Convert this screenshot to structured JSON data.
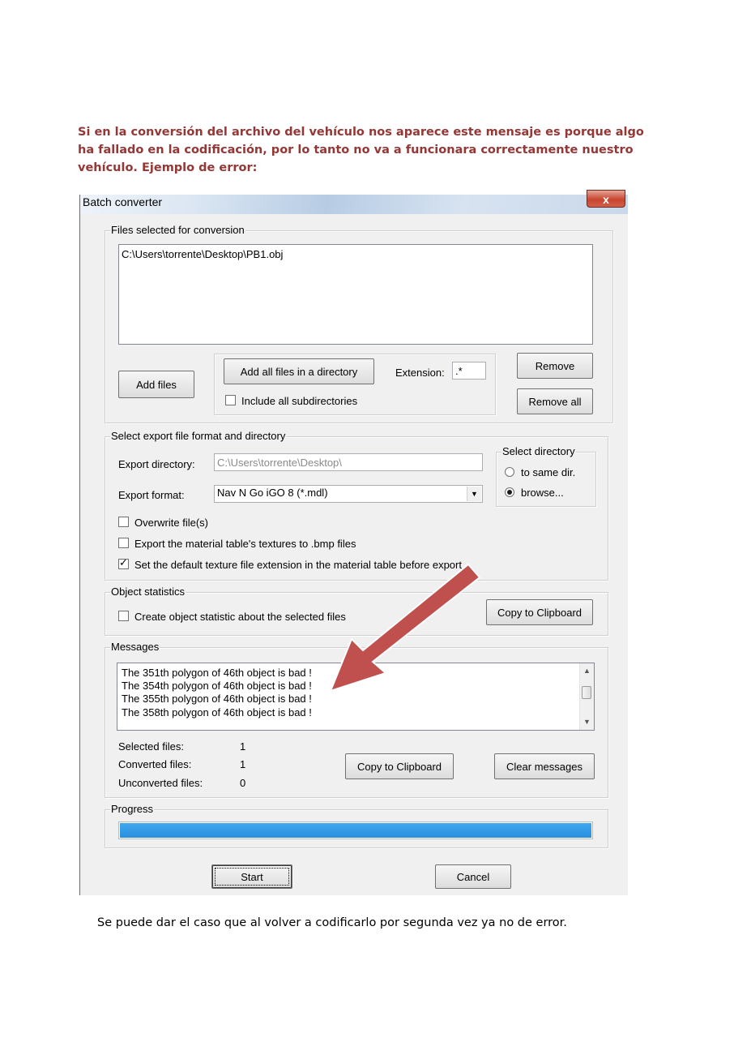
{
  "intro_text": "Si en la conversión del archivo del vehículo nos aparece este mensaje es porque algo ha fallado en la codificación, por lo tanto no va a funcionara correctamente nuestro vehículo. Ejemplo de error:",
  "outro_text": "Se puede dar el caso que al volver a codificarlo por segunda vez ya no de error.",
  "window": {
    "title": "Batch converter",
    "close_glyph": "x"
  },
  "files_group": {
    "label": "Files selected for conversion",
    "files": [
      "C:\\Users\\torrente\\Desktop\\PB1.obj"
    ],
    "add_files_label": "Add files",
    "add_dir_label": "Add all files in a directory",
    "extension_label": "Extension:",
    "extension_value": ".*",
    "include_subdirs_label": "Include all subdirectories",
    "include_subdirs_checked": false,
    "remove_label": "Remove",
    "remove_all_label": "Remove all"
  },
  "export_group": {
    "label": "Select export file format and directory",
    "export_dir_label": "Export directory:",
    "export_dir_value": "C:\\Users\\torrente\\Desktop\\",
    "export_format_label": "Export format:",
    "export_format_value": "Nav N Go iGO 8 (*.mdl)",
    "overwrite_label": "Overwrite file(s)",
    "overwrite_checked": false,
    "export_textures_label": "Export the material table's textures to .bmp files",
    "export_textures_checked": false,
    "default_ext_label": "Set the default texture file extension in the material table before export",
    "default_ext_checked": true,
    "select_dir_label": "Select directory",
    "same_dir_label": "to same dir.",
    "browse_label": "browse...",
    "selected_dir_option": "browse"
  },
  "stats_group": {
    "label": "Object statistics",
    "create_stats_label": "Create object statistic about the selected files",
    "create_stats_checked": false,
    "copy_label": "Copy to Clipboard"
  },
  "messages_group": {
    "label": "Messages",
    "messages": [
      "The 351th polygon of 46th object is bad !",
      "The 354th polygon of 46th object is bad !",
      "The 355th polygon of 46th object is bad !",
      "The 358th polygon of 46th object is bad !"
    ],
    "selected_files_label": "Selected files:",
    "selected_files_value": "1",
    "converted_files_label": "Converted files:",
    "converted_files_value": "1",
    "unconverted_files_label": "Unconverted files:",
    "unconverted_files_value": "0",
    "copy_label": "Copy to Clipboard",
    "clear_label": "Clear messages"
  },
  "progress_group": {
    "label": "Progress",
    "progress_fraction": 1.0
  },
  "footer": {
    "start_label": "Start",
    "cancel_label": "Cancel"
  },
  "colors": {
    "heading_text": "#953735",
    "progress_fill": "#2a8fe0",
    "annotation_arrow": "#c0504d"
  }
}
